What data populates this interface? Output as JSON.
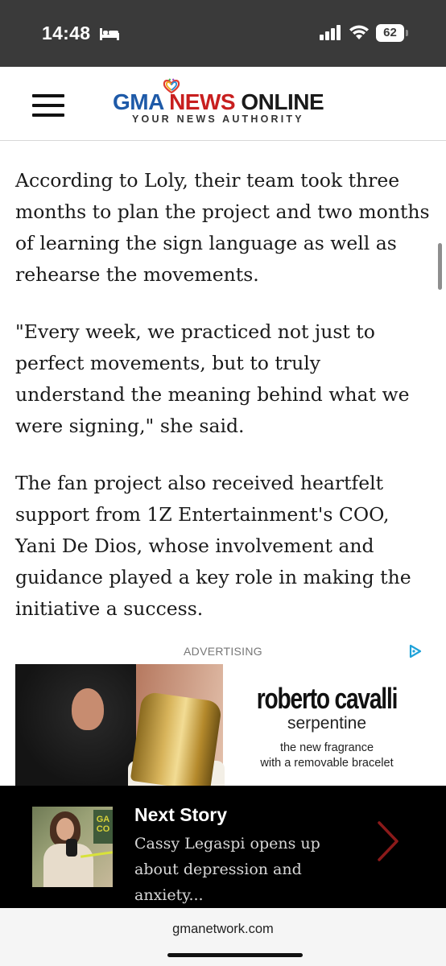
{
  "status_bar": {
    "time": "14:48",
    "battery": "62",
    "icons": [
      "bed-icon",
      "signal-icon",
      "wifi-icon",
      "battery-icon"
    ]
  },
  "header": {
    "menu_icon": "hamburger-menu-icon",
    "logo": {
      "gma": "GMA",
      "news": "NEWS",
      "online": "ONLINE",
      "tagline": "YOUR NEWS AUTHORITY"
    }
  },
  "article": {
    "paragraphs": [
      "According to Loly, their team took three months to plan the project and two months of learning the sign language as well as rehearse the movements.",
      "\"Every week, we practiced not just to perfect movements, but to truly understand the meaning behind what we were signing,\" she said.",
      "The fan project also received heartfelt support from 1Z Entertainment's COO, Yani De Dios, whose involvement and guidance played a key role in making the initiative a success."
    ]
  },
  "ad": {
    "label": "ADVERTISING",
    "brand": "roberto cavalli",
    "product": "serpentine",
    "tagline_line1": "the new fragrance",
    "tagline_line2": "with a removable bracelet"
  },
  "next_story": {
    "title": "Next Story",
    "headline": "Cassy Legaspi opens up about depression and anxiety...",
    "thumb_sign": "GA CO"
  },
  "browser": {
    "url": "gmanetwork.com"
  },
  "colors": {
    "status_bar_bg": "#3a3a3a",
    "gma_blue": "#1e5aa8",
    "news_red": "#c81f1f",
    "next_story_bg": "#000000",
    "chevron_red": "#8b1a1a"
  }
}
